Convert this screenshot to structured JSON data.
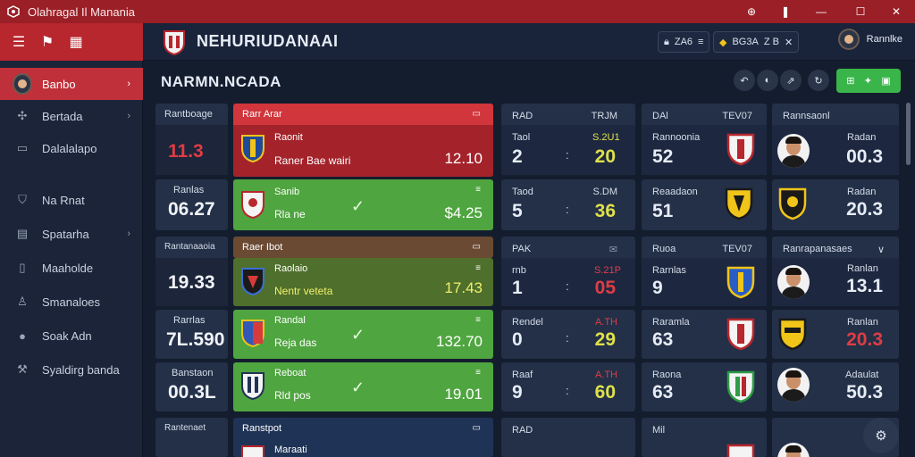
{
  "titlebar": {
    "title": "Olahragal Il Manania",
    "buttons": [
      "⊕",
      "❚",
      "—",
      "☐",
      "✕"
    ]
  },
  "header": {
    "title": "NEHURIUDANAAI",
    "lock_label": "ZA6",
    "lock_sub": "≡",
    "filter_label": "BG3A",
    "filter_extra": "Z B",
    "close": "✕",
    "user_name": "Rannlke"
  },
  "sidebar": {
    "items": [
      {
        "label": "Banbo",
        "icon": "avatar"
      },
      {
        "label": "Bertada",
        "icon": "fan-icon"
      },
      {
        "label": "Dalalalapo",
        "icon": "monitor-icon"
      },
      {
        "label": "Na Rnat",
        "icon": "shield-icon"
      },
      {
        "label": "Spatarha",
        "icon": "chart-icon"
      },
      {
        "label": "Maaholde",
        "icon": "bookmark-icon"
      },
      {
        "label": "Smanaloes",
        "icon": "person-icon"
      },
      {
        "label": "Soak Adn",
        "icon": "circle-icon"
      },
      {
        "label": "Syaldirg banda",
        "icon": "wrench-icon"
      }
    ]
  },
  "page": {
    "title": "NARMN.NCADA"
  },
  "left_col": [
    {
      "label": "Rantboage",
      "value": "11.3",
      "value_color": "#e03c45"
    },
    {
      "label": "Ranlas",
      "value": "06.27"
    },
    {
      "label": "Rantanaaoia",
      "value": ""
    },
    {
      "label": "",
      "value": "19.33"
    },
    {
      "label": "Rarrlas",
      "value": "7L.590"
    },
    {
      "label": "Banstaon",
      "value": "00.3L"
    },
    {
      "label": "Rantenaet",
      "value": ""
    }
  ],
  "matches": [
    {
      "head": "Rarr Arar",
      "team": "Raonit",
      "sub": "Raner Bae wairi",
      "odds": "12.10"
    },
    {
      "head": "",
      "team": "Sanib",
      "sub": "Rla ne",
      "odds": "$4.25",
      "mini": "≡"
    },
    {
      "head": "Raer Ibot",
      "team": "",
      "sub": "",
      "odds": ""
    },
    {
      "head": "",
      "team": "Raolaio",
      "sub": "Nentr veteta",
      "odds": "17.43",
      "mini": "≡"
    },
    {
      "head": "",
      "team": "Randal",
      "sub": "Reja das",
      "odds": "132.70",
      "mini": "≡"
    },
    {
      "head": "",
      "team": "Reboat",
      "sub": "Rld pos",
      "odds": "19.01",
      "mini": "≡"
    },
    {
      "head": "Ranstpot",
      "team": "Maraati",
      "sub": "",
      "odds": ""
    }
  ],
  "stats_col": [
    {
      "k": "RAD",
      "kr": "TRJM",
      "v": "",
      "vr": ""
    },
    {
      "k": "Taol",
      "kr": "S.2U1",
      "v": "2",
      "vr": "20"
    },
    {
      "k": "Taod",
      "kr": "S.DM",
      "v": "5",
      "vr": "36"
    },
    {
      "k": "PAK",
      "kr": "",
      "v": "",
      "vr": ""
    },
    {
      "k": "rnb",
      "kr": "S.21P",
      "v": "1",
      "vr": "05"
    },
    {
      "k": "Rendel",
      "kr": "A.TH",
      "v": "0",
      "vr": "29"
    },
    {
      "k": "Raaf",
      "kr": "A.TH",
      "v": "9",
      "vr": "60"
    },
    {
      "k": "RAD",
      "kr": "",
      "v": "",
      "vr": ""
    }
  ],
  "teams_col": [
    {
      "k": "DAl",
      "kr": "TEV07",
      "v": ""
    },
    {
      "k": "Rannoonia",
      "v": "52"
    },
    {
      "k": "Reaadaon",
      "v": "51"
    },
    {
      "k": "Ruoa",
      "kr": "TEV07",
      "v": ""
    },
    {
      "k": "Rarnlas",
      "v": "9"
    },
    {
      "k": "Raramla",
      "v": "63"
    },
    {
      "k": "Raona",
      "v": "63"
    },
    {
      "k": "Mil",
      "v": ""
    }
  ],
  "players_col": [
    {
      "k": "Rannsaonl",
      "kr": "",
      "vr": ""
    },
    {
      "k": "",
      "kr": "Radan",
      "vr": "00.3"
    },
    {
      "k": "",
      "kr": "Radan",
      "vr": "20.3"
    },
    {
      "k": "Ranrapanasaes",
      "kr": "∨",
      "vr": ""
    },
    {
      "k": "",
      "kr": "Ranlan",
      "vr": "13.1"
    },
    {
      "k": "",
      "kr": "Ranlan",
      "vr": "20.3"
    },
    {
      "k": "",
      "kr": "Adaulat",
      "vr": "50.3"
    }
  ],
  "toolbar": {
    "buttons": [
      "↶",
      "◐",
      "⇗",
      "↻"
    ],
    "green_icons": [
      "⊞",
      "✦",
      "▣"
    ]
  },
  "colors": {
    "red": "#b8262e",
    "green": "#4fa53f",
    "panel": "#233048",
    "accent_yellow": "#e0e04a"
  }
}
